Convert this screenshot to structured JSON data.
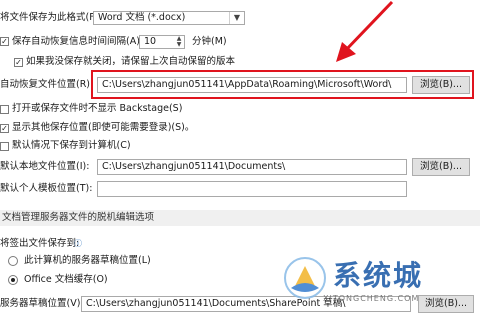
{
  "rows": {
    "save_format_label": "将文件保存为此格式(F):",
    "save_format_value": "Word 文档 (*.docx)",
    "autorecover_label": "保存自动恢复信息时间间隔(A)",
    "autorecover_value": "10",
    "minutes_label": "分钟(M)",
    "keep_last_label": "如果我没保存就关闭，请保留上次自动保留的版本",
    "autorecover_location_label": "自动恢复文件位置(R):",
    "autorecover_location_value": "C:\\Users\\zhangjun051141\\AppData\\Roaming\\Microsoft\\Word\\",
    "browse_label": "浏览(B)...",
    "no_backstage_label": "打开或保存文件时不显示 Backstage(S)",
    "show_additional_label": "显示其他保存位置(即使可能需要登录)(S)。",
    "default_computer_label": "默认情况下保存到计算机(C)",
    "default_local_label": "默认本地文件位置(I):",
    "default_local_value": "C:\\Users\\zhangjun051141\\Documents\\",
    "default_template_label": "默认个人模板位置(T):",
    "default_template_value": "",
    "offline_section": "文档管理服务器文件的脱机编辑选项",
    "checkout_label": "将签出文件保存到:",
    "server_drafts_label": "此计算机的服务器草稿位置(L)",
    "office_cache_label": "Office 文档缓存(O)",
    "server_drafts_location_label": "服务器草稿位置(V):",
    "server_drafts_location_value": "C:\\Users\\zhangjun051141\\Documents\\SharePoint 草稿\\"
  },
  "checkboxes": {
    "autorecover": true,
    "keep_last": true,
    "no_backstage": false,
    "show_additional": true,
    "default_computer": false
  },
  "radios": {
    "selected": "office_cache"
  },
  "watermark": {
    "cn": "系统城",
    "url": "XITONGCHENG.COM"
  },
  "colors": {
    "highlight": "#e0141e",
    "section_bg": "#f0f0f0"
  }
}
